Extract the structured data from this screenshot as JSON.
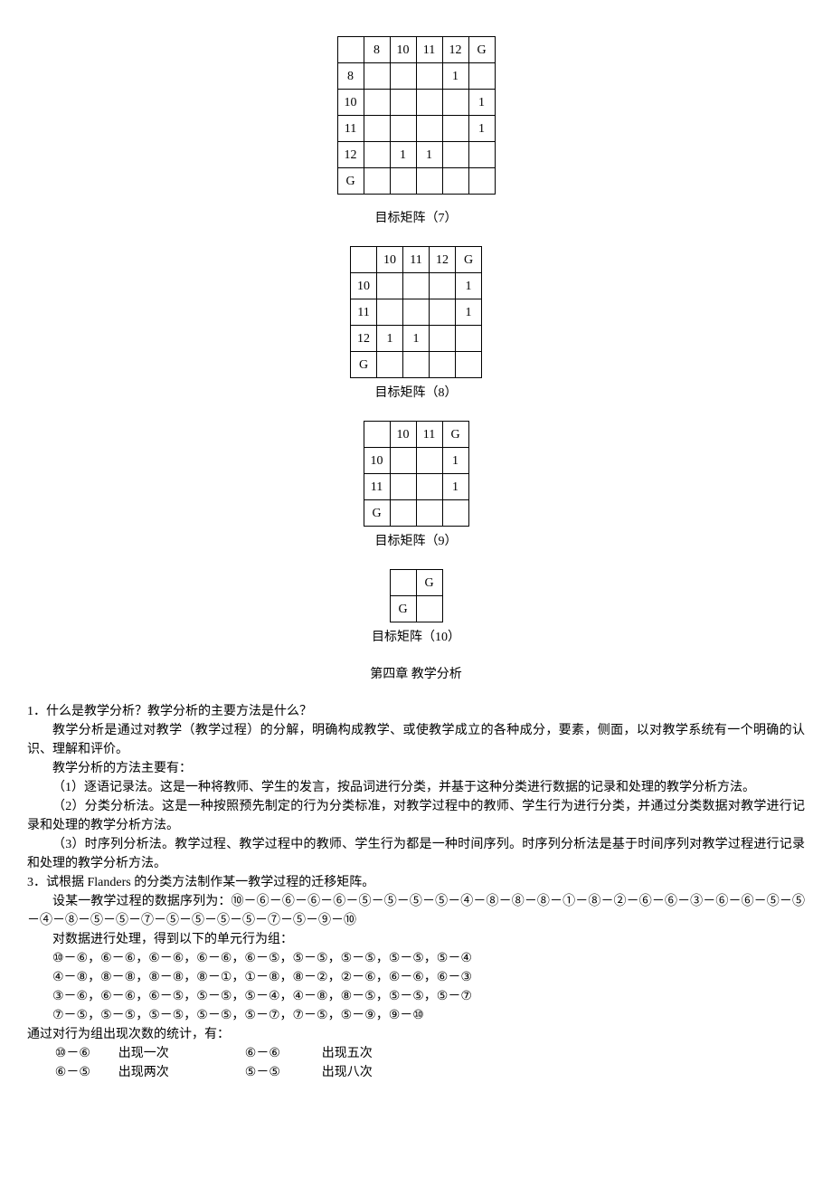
{
  "chart_data": [
    {
      "type": "table",
      "title": "目标矩阵（7）",
      "columns": [
        "",
        "8",
        "10",
        "11",
        "12",
        "G"
      ],
      "rows": [
        [
          "8",
          "",
          "",
          "",
          "1",
          ""
        ],
        [
          "10",
          "",
          "",
          "",
          "",
          "1"
        ],
        [
          "11",
          "",
          "",
          "",
          "",
          "1"
        ],
        [
          "12",
          "",
          "1",
          "1",
          "",
          ""
        ],
        [
          "G",
          "",
          "",
          "",
          "",
          ""
        ]
      ]
    },
    {
      "type": "table",
      "title": "目标矩阵（8）",
      "columns": [
        "",
        "10",
        "11",
        "12",
        "G"
      ],
      "rows": [
        [
          "10",
          "",
          "",
          "",
          "1"
        ],
        [
          "11",
          "",
          "",
          "",
          "1"
        ],
        [
          "12",
          "1",
          "1",
          "",
          ""
        ],
        [
          "G",
          "",
          "",
          "",
          ""
        ]
      ]
    },
    {
      "type": "table",
      "title": "目标矩阵（9）",
      "columns": [
        "",
        "10",
        "11",
        "G"
      ],
      "rows": [
        [
          "10",
          "",
          "",
          "1"
        ],
        [
          "11",
          "",
          "",
          "1"
        ],
        [
          "G",
          "",
          "",
          ""
        ]
      ]
    },
    {
      "type": "table",
      "title": "目标矩阵（10）",
      "columns": [
        "",
        "G"
      ],
      "rows": [
        [
          "G",
          ""
        ]
      ]
    }
  ],
  "chapter": "第四章 教学分析",
  "q1": "1．什么是教学分析？教学分析的主要方法是什么？",
  "p1": "教学分析是通过对教学（教学过程）的分解，明确构成教学、或使教学成立的各种成分，要素，侧面，以对教学系统有一个明确的认识、理解和评价。",
  "p2": "教学分析的方法主要有：",
  "p3": "（1）逐语记录法。这是一种将教师、学生的发言，按品词进行分类，并基于这种分类进行数据的记录和处理的教学分析方法。",
  "p4": "（2）分类分析法。这是一种按照预先制定的行为分类标准，对教学过程中的教师、学生行为进行分类，并通过分类数据对教学进行记录和处理的教学分析方法。",
  "p5": "（3）时序列分析法。教学过程、教学过程中的教师、学生行为都是一种时间序列。时序列分析法是基于时间序列对教学过程进行记录和处理的教学分析方法。",
  "q3": "3．试根据 Flanders 的分类方法制作某一教学过程的迁移矩阵。",
  "p6": "设某一教学过程的数据序列为：⑩－⑥－⑥－⑥－⑥－⑤－⑤－⑤－⑤－④－⑧－⑧－⑧－①－⑧－②－⑥－⑥－③－⑥－⑥－⑤－⑤－④－⑧－⑤－⑤－⑦－⑤－⑤－⑤－⑤－⑦－⑤－⑨－⑩",
  "p7": "对数据进行处理，得到以下的单元行为组：",
  "g1": "⑩－⑥，⑥－⑥，⑥－⑥，⑥－⑥，⑥－⑤，⑤－⑤，⑤－⑤，⑤－⑤，⑤－④",
  "g2": "④－⑧，⑧－⑧，⑧－⑧，⑧－①，①－⑧，⑧－②，②－⑥，⑥－⑥，⑥－③",
  "g3": "③－⑥，⑥－⑥，⑥－⑤，⑤－⑤，⑤－④，④－⑧，⑧－⑤，⑤－⑤，⑤－⑦",
  "g4": "⑦－⑤，⑤－⑤，⑤－⑤，⑤－⑤，⑤－⑦，⑦－⑤，⑤－⑨，⑨－⑩",
  "p8": "通过对行为组出现次数的统计，有：",
  "freq": [
    {
      "a": "⑩－⑥",
      "b": "出现一次",
      "c": "⑥－⑥",
      "d": "出现五次"
    },
    {
      "a": "⑥－⑤",
      "b": "出现两次",
      "c": "⑤－⑤",
      "d": "出现八次"
    }
  ]
}
